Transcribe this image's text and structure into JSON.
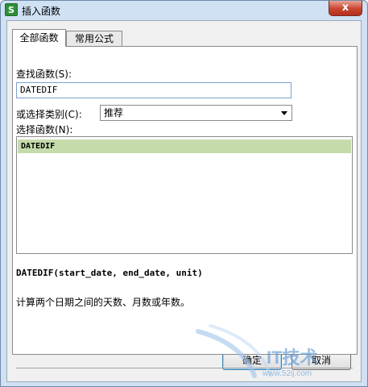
{
  "window": {
    "title": "插入函数",
    "app_icon": "S",
    "close_label": "x"
  },
  "tabs": [
    {
      "label": "全部函数",
      "active": true
    },
    {
      "label": "常用公式",
      "active": false
    }
  ],
  "search": {
    "label": "查找函数(S):",
    "value": "DATEDIF"
  },
  "category": {
    "label": "或选择类别(C):",
    "selected": "推荐"
  },
  "function_list": {
    "label": "选择函数(N):",
    "items": [
      "DATEDIF"
    ],
    "selected_index": 0
  },
  "details": {
    "signature": "DATEDIF(start_date, end_date, unit)",
    "description": "计算两个日期之间的天数、月数或年数。"
  },
  "buttons": {
    "ok_label": "确定",
    "cancel_label": "取消"
  },
  "watermark": {
    "text": "IT技术",
    "url": "www.52ij.com"
  },
  "colors": {
    "selection": "#c5dbab",
    "titlebar": "#cfe1f3",
    "close_button": "#c8452f"
  }
}
